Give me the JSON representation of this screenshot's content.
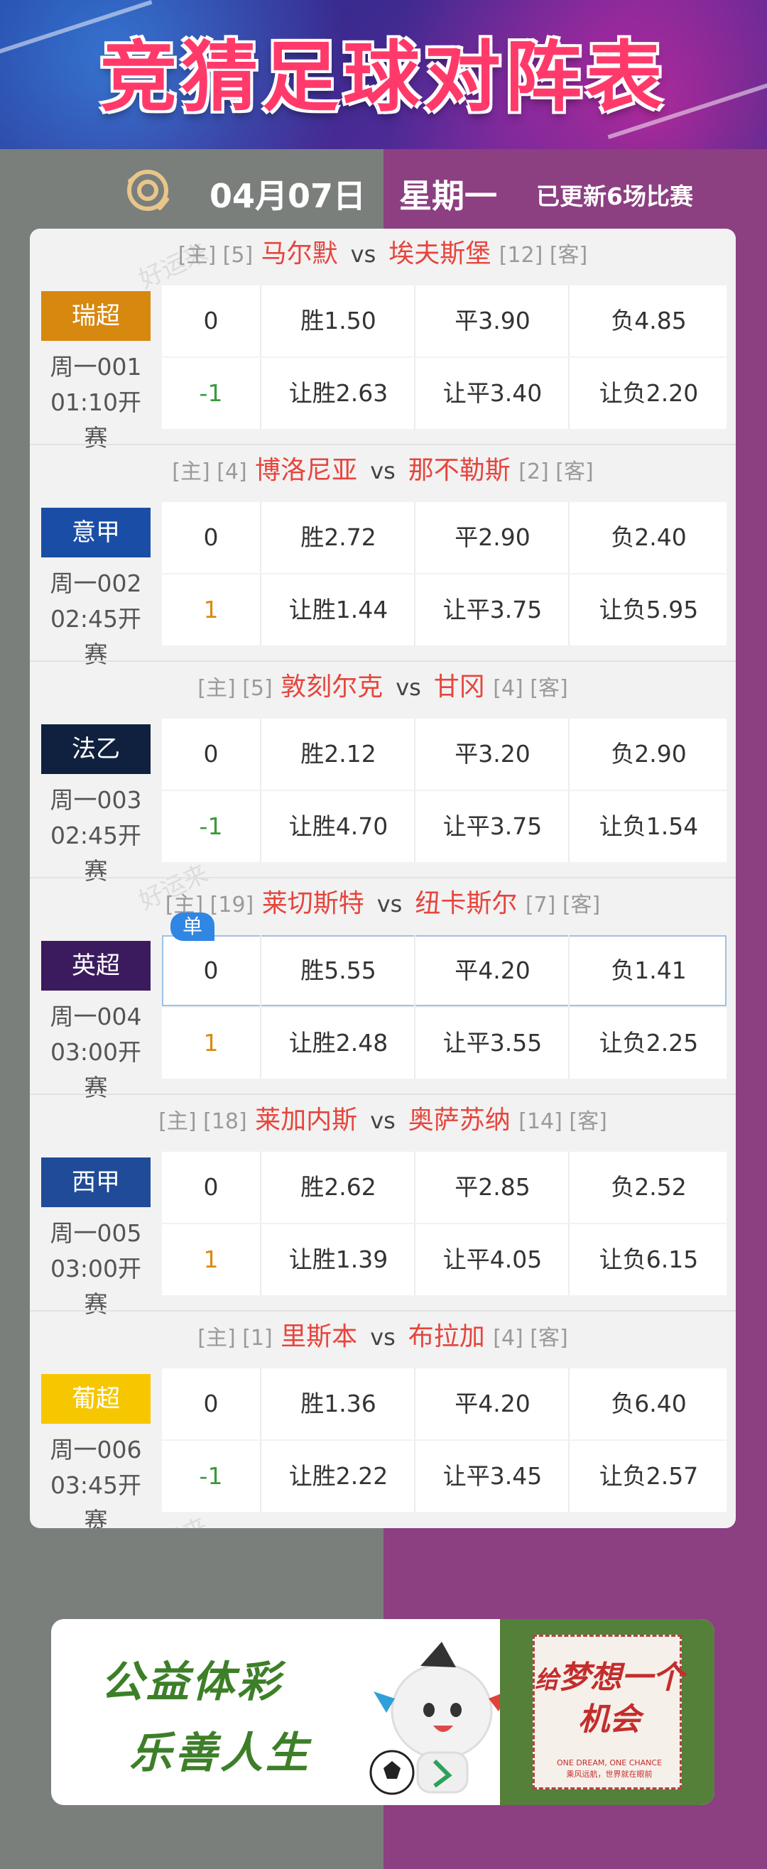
{
  "banner": {
    "title": "竞猜足球对阵表"
  },
  "header": {
    "date": "04月07日",
    "weekday": "星期一",
    "updated": "已更新6场比赛"
  },
  "watermark": "好运来",
  "single_label": "单",
  "matches": [
    {
      "home_meta_left": "[主] [5]",
      "home": "马尔默",
      "vs": "vs",
      "away": "埃夫斯堡",
      "away_meta_right": "[12] [客]",
      "league": "瑞超",
      "league_color": "#d7880f",
      "code": "周一001",
      "kickoff": "01:10开赛",
      "row1": [
        "0",
        "胜1.50",
        "平3.90",
        "负4.85"
      ],
      "row2": [
        "-1",
        "让胜2.63",
        "让平3.40",
        "让负2.20"
      ],
      "handicap_color": "#3a9a3a"
    },
    {
      "home_meta_left": "[主] [4]",
      "home": "博洛尼亚",
      "vs": "vs",
      "away": "那不勒斯",
      "away_meta_right": "[2] [客]",
      "league": "意甲",
      "league_color": "#1a4ea6",
      "code": "周一002",
      "kickoff": "02:45开赛",
      "row1": [
        "0",
        "胜2.72",
        "平2.90",
        "负2.40"
      ],
      "row2": [
        "1",
        "让胜1.44",
        "让平3.75",
        "让负5.95"
      ],
      "handicap_color": "#d98a12"
    },
    {
      "home_meta_left": "[主] [5]",
      "home": "敦刻尔克",
      "vs": "vs",
      "away": "甘冈",
      "away_meta_right": "[4] [客]",
      "league": "法乙",
      "league_color": "#10213f",
      "code": "周一003",
      "kickoff": "02:45开赛",
      "row1": [
        "0",
        "胜2.12",
        "平3.20",
        "负2.90"
      ],
      "row2": [
        "-1",
        "让胜4.70",
        "让平3.75",
        "让负1.54"
      ],
      "handicap_color": "#3a9a3a"
    },
    {
      "home_meta_left": "[主] [19]",
      "home": "莱切斯特",
      "vs": "vs",
      "away": "纽卡斯尔",
      "away_meta_right": "[7] [客]",
      "league": "英超",
      "league_color": "#3b1a5e",
      "code": "周一004",
      "kickoff": "03:00开赛",
      "row1": [
        "0",
        "胜5.55",
        "平4.20",
        "负1.41"
      ],
      "row2": [
        "1",
        "让胜2.48",
        "让平3.55",
        "让负2.25"
      ],
      "handicap_color": "#d98a12"
    },
    {
      "home_meta_left": "[主] [18]",
      "home": "莱加内斯",
      "vs": "vs",
      "away": "奥萨苏纳",
      "away_meta_right": "[14] [客]",
      "league": "西甲",
      "league_color": "#1f4b98",
      "code": "周一005",
      "kickoff": "03:00开赛",
      "row1": [
        "0",
        "胜2.62",
        "平2.85",
        "负2.52"
      ],
      "row2": [
        "1",
        "让胜1.39",
        "让平4.05",
        "让负6.15"
      ],
      "handicap_color": "#d98a12"
    },
    {
      "home_meta_left": "[主] [1]",
      "home": "里斯本",
      "vs": "vs",
      "away": "布拉加",
      "away_meta_right": "[4] [客]",
      "league": "葡超",
      "league_color": "#f6c700",
      "code": "周一006",
      "kickoff": "03:45开赛",
      "row1": [
        "0",
        "胜1.36",
        "平4.20",
        "负6.40"
      ],
      "row2": [
        "-1",
        "让胜2.22",
        "让平3.45",
        "让负2.57"
      ],
      "handicap_color": "#3a9a3a"
    }
  ],
  "footer": {
    "slogan1": "公益体彩",
    "slogan2": "乐善人生",
    "poster_line1": "梦想一个",
    "poster_line2": "给",
    "poster_line3": "机会",
    "poster_en": "ONE DREAM, ONE CHANCE",
    "poster_cn": "乘风远航，世界就在眼前"
  }
}
